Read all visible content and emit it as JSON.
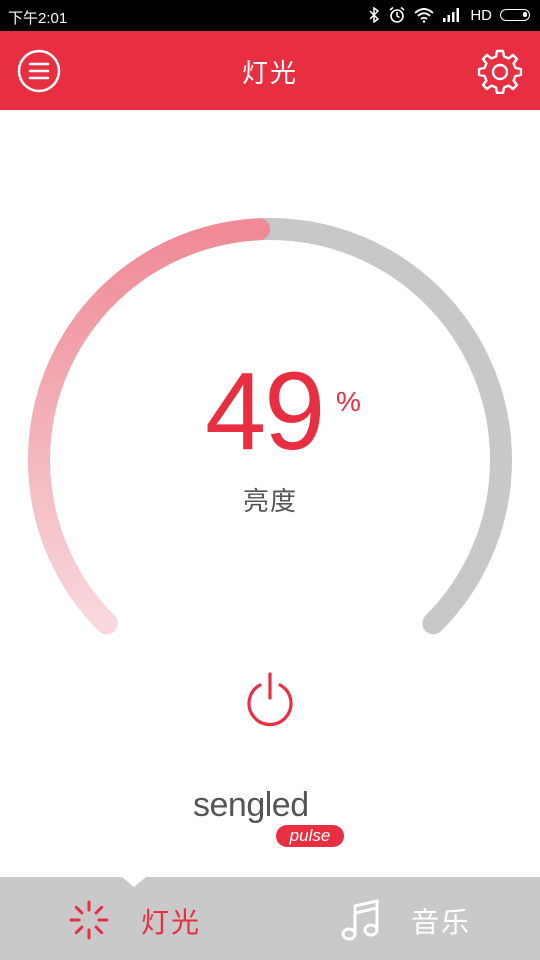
{
  "status_bar": {
    "time": "下午2:01",
    "network": "HD",
    "icons": [
      "bluetooth-icon",
      "alarm-icon",
      "wifi-icon",
      "signal-icon",
      "battery-icon"
    ]
  },
  "header": {
    "title": "灯光",
    "menu_icon": "menu-icon",
    "settings_icon": "gear-icon"
  },
  "dial": {
    "value": "49",
    "unit": "%",
    "label": "亮度",
    "brightness_fraction": 0.49,
    "active_color": "#e82f42",
    "track_color": "#c8c8c8"
  },
  "power": {
    "icon": "power-icon"
  },
  "brand": {
    "name": "sengled",
    "sub": "pulse"
  },
  "tabs": [
    {
      "label": "灯光",
      "icon": "light-icon",
      "active": true
    },
    {
      "label": "音乐",
      "icon": "music-note-icon",
      "active": false
    }
  ],
  "colors": {
    "accent": "#e82f42",
    "tabbar": "#c9c9c9"
  }
}
